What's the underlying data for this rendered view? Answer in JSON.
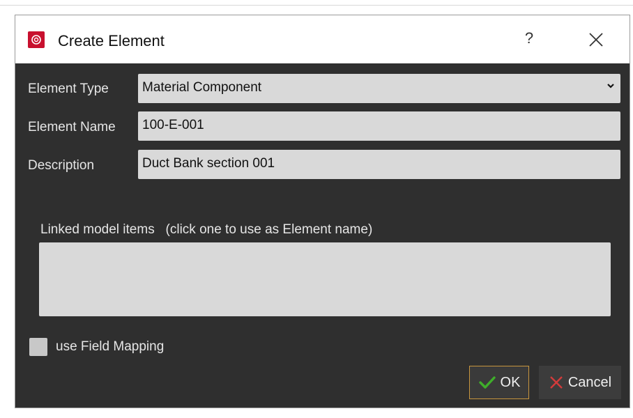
{
  "window": {
    "title": "Create Element",
    "help_glyph": "?",
    "icon": "app-logo-icon",
    "brand_color": "#c8102e"
  },
  "form": {
    "element_type_label": "Element Type",
    "element_type_value": "Material Component",
    "element_name_label": "Element Name",
    "element_name_value": "100-E-001",
    "description_label": "Description",
    "description_value": "Duct Bank section 001"
  },
  "linked": {
    "label": "Linked model items   (click one to use as Element name)",
    "items": []
  },
  "field_mapping": {
    "label": "use Field Mapping",
    "checked": false
  },
  "buttons": {
    "ok_label": "OK",
    "ok_icon": "check-icon",
    "ok_icon_color": "#3fae2a",
    "cancel_label": "Cancel",
    "cancel_icon": "x-icon",
    "cancel_icon_color": "#d23b3b"
  }
}
